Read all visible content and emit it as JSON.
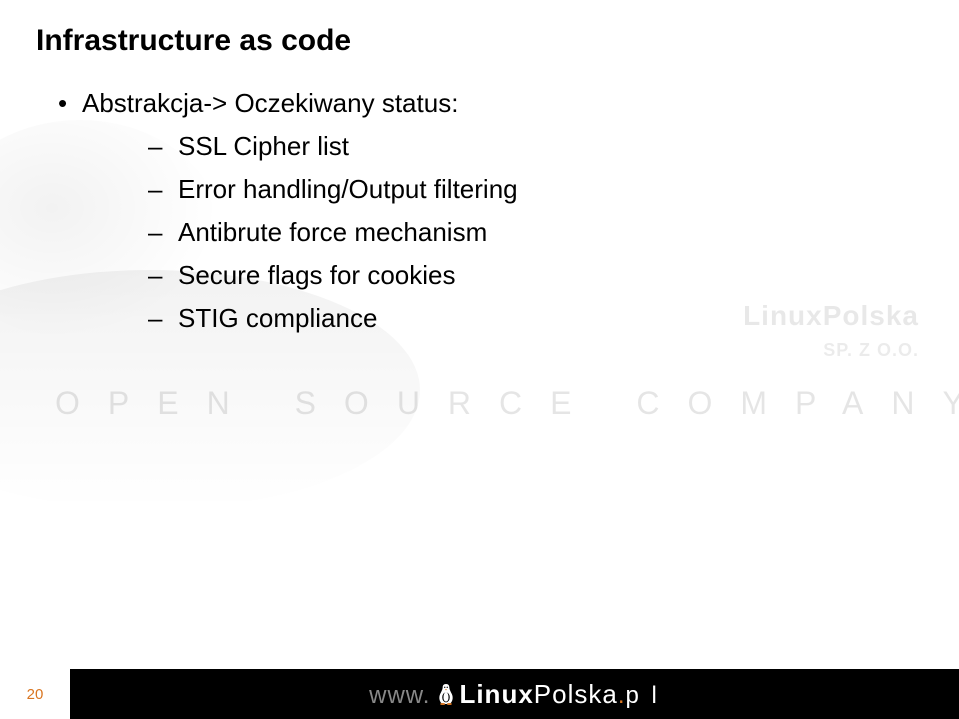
{
  "title": "Infrastructure as code",
  "bullet": {
    "label": "Abstrakcja-> Oczekiwany status:",
    "items": [
      "SSL Cipher list",
      "Error handling/Output filtering",
      "Antibrute force mechanism",
      "Secure flags for cookies",
      "STIG compliance"
    ]
  },
  "watermark": {
    "company": "LinuxPolska",
    "sub": "SP. Z O.O.",
    "tagline": "OPEN SOURCE COMPANY"
  },
  "footer": {
    "page": "20",
    "url_www": "www.",
    "url_linux": "Linux",
    "url_polska": "Polska",
    "url_sep": ".",
    "url_pl": "p l"
  }
}
